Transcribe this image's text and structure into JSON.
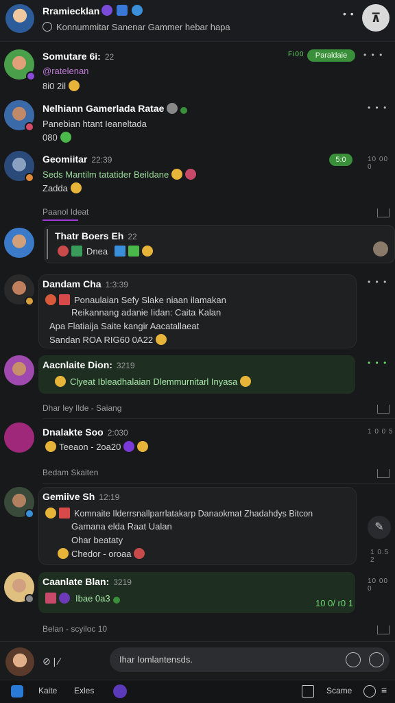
{
  "header": {
    "title": "Rramiecklan",
    "subtitle": "Konnummitar Sanenar Gammer hebar hapa",
    "more": "• •",
    "action_glyph": "⊼"
  },
  "messages": [
    {
      "name": "Somutare 6i:",
      "meta": "22",
      "handle": "@ratelenan",
      "line2": "8i0 2il",
      "pill_label": "Paraldaie",
      "pill_prefix": "Fi00",
      "time": "",
      "dots": "• • •"
    },
    {
      "name": "Nelhiann Gamerlada Ratae",
      "meta": "",
      "line1": "Panebian htant Ieaneltada",
      "line2": "080",
      "dots": "• • •"
    },
    {
      "name": "Geomiitar",
      "meta": "22:39",
      "line1": "Seds  Mantilm tatatider  BeiIdane",
      "line2": "Zadda",
      "pill_label": "5:0",
      "time": "10 00 0"
    },
    {
      "name": "Thatr Boers Eh",
      "meta": "22",
      "line1": "Dnea",
      "section_label": "Paanol Ideat"
    },
    {
      "name": "Dandam Cha",
      "meta": "1:3:39",
      "lines": [
        "Ponaulaian Sefy Slake niaan ilamakan",
        "Reikannang adanie Iidan: Caita Kalan",
        "Apa Flatiaija Saite kangir Aacatallaeat",
        "Sandan  ROA RIG60 0A22"
      ],
      "dots": "• • •"
    },
    {
      "name": "Aacnlaite Dion:",
      "meta": "3219",
      "line1": "Clyeat Ibleadhalaian Dlemmurnitarl Inyasa",
      "dots": "• • •",
      "section_label": "Dhar ley Ilde - Saiang"
    },
    {
      "name": "Dnalakte Soo",
      "meta": "2:030",
      "line1": "Teeaon - 2oa20",
      "time": "1 0 0 5",
      "section_label": "Bedam Skaiten"
    },
    {
      "name": "Gemiive Sh",
      "meta": "12:19",
      "lines": [
        "Komnaite Ilderrsnallparrlatakarp  Danaokmat Zhadahdys Bitcon",
        "Gamana elda  Raat Ualan",
        "Ohar beataty",
        "Chedor - oroaa"
      ],
      "time": "1 0.5 2"
    },
    {
      "name": "Caanlate Blan:",
      "meta": "3219",
      "line1": "Ibae 0a3",
      "stamp": "10 0/ r0 1",
      "time": "10 00 0"
    }
  ],
  "footer_sep": "Belan - scyiloc  10",
  "composer": {
    "placeholder": "Ihar Iomlantensds.",
    "icons": "⊘  |  ⁄"
  },
  "bottom_nav": {
    "item1": "Kaite",
    "item2": "Exles",
    "item3": "Scame"
  },
  "colors": {
    "background": "#18191b",
    "accent_green": "#3a8f3a",
    "accent_purple": "#9b3ad8"
  }
}
